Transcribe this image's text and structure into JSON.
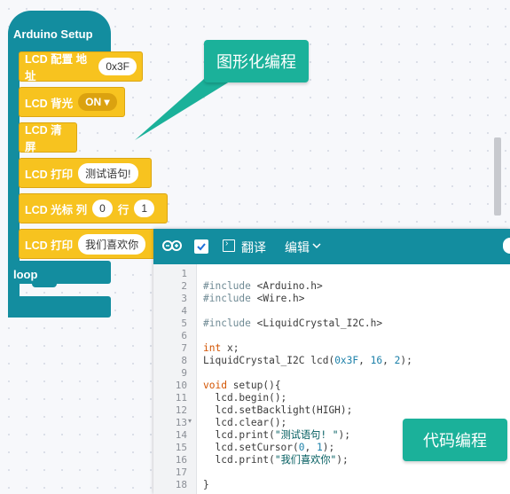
{
  "workspace": {
    "setup_label": "Arduino Setup",
    "loop_label": "loop",
    "blocks": [
      {
        "label": "LCD 配置 地址",
        "field": "0x3F"
      },
      {
        "label": "LCD 背光",
        "dropdown": "ON"
      },
      {
        "label": "LCD 清屏"
      },
      {
        "label": "LCD 打印",
        "field": "测试语句!"
      },
      {
        "label": "LCD 光标 列",
        "field": "0",
        "label2": "行",
        "field2": "1"
      },
      {
        "label": "LCD 打印",
        "field": "我们喜欢你"
      }
    ]
  },
  "callouts": {
    "graphical": "图形化编程",
    "code": "代码编程"
  },
  "editor": {
    "translate_label": "翻译",
    "edit_label": "编辑",
    "line_numbers": [
      "1",
      "2",
      "3",
      "4",
      "5",
      "6",
      "7",
      "8",
      "9",
      "10",
      "11",
      "12",
      "13",
      "14",
      "15",
      "16",
      "17",
      "18"
    ],
    "code_lines": {
      "l2_kw": "#include",
      "l2_rest": " <Arduino.h>",
      "l3_kw": "#include",
      "l3_rest": " <Wire.h>",
      "l5_kw": "#include",
      "l5_rest": " <LiquidCrystal_I2C.h>",
      "l7_kw": "int",
      "l7_rest": " x;",
      "l8_a": "LiquidCrystal_I2C lcd(",
      "l8_b": "0x3F",
      "l8_c": ", ",
      "l8_d": "16",
      "l8_e": ", ",
      "l8_f": "2",
      "l8_g": ");",
      "l10_kw": "void",
      "l10_rest": " setup(){",
      "l11": "  lcd.begin();",
      "l12": "  lcd.setBacklight(HIGH);",
      "l13": "  lcd.clear();",
      "l14_a": "  lcd.print(",
      "l14_b": "\"测试语句! \"",
      "l14_c": ");",
      "l15_a": "  lcd.setCursor(",
      "l15_b": "0",
      "l15_c": ", ",
      "l15_d": "1",
      "l15_e": ");",
      "l16_a": "  lcd.print(",
      "l16_b": "\"我们喜欢你\"",
      "l16_c": ");",
      "l18": "}"
    }
  }
}
